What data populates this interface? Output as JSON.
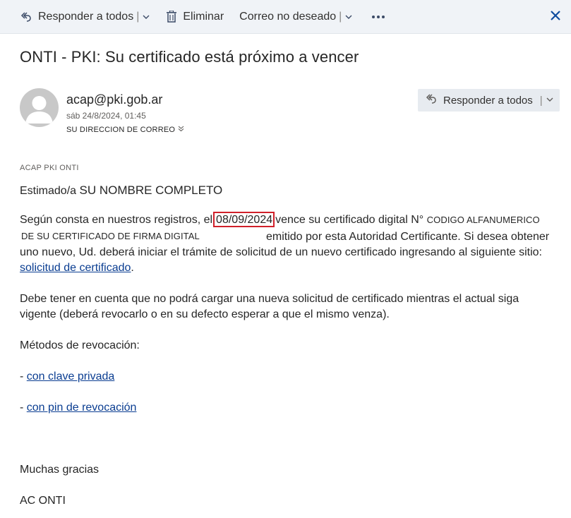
{
  "toolbar": {
    "reply_all_label": "Responder a todos",
    "delete_label": "Eliminar",
    "junk_label": "Correo no deseado",
    "more_icon": "more-icon",
    "close_icon": "close-icon"
  },
  "email": {
    "subject": "ONTI - PKI: Su certificado está próximo a vencer",
    "sender": "acap@pki.gob.ar",
    "date": "sáb 24/8/2024, 01:45",
    "recipient": "SU DIRECCION DE CORREO",
    "reply_all_label": "Responder a todos",
    "org": "ACAP PKI ONTI"
  },
  "body": {
    "greeting_prefix": "Estimado/a",
    "greeting_name": "SU NOMBRE COMPLETO",
    "p1_a": "Según consta en nuestros registros, el",
    "p1_date": "08/09/2024",
    "p1_b": "vence su certificado digital N°",
    "p1_code_1": "CODIGO ALFANUMERICO",
    "p1_code_2": "DE SU CERTIFICADO DE FIRMA DIGITAL",
    "p1_c": "emitido por esta Autoridad Certificante. Si desea obtener",
    "p1_d": "uno nuevo, Ud. deberá iniciar el trámite de solicitud de un nuevo certificado ingresando al siguiente sitio:",
    "p1_link": "solicitud de certificado",
    "p1_end": ".",
    "p2_a": "Debe tener en cuenta que no podrá cargar una nueva solicitud de certificado mientras el actual siga",
    "p2_b": "vigente (deberá revocarlo o en su defecto esperar a que el mismo venza).",
    "methods_title": "Métodos de revocación:",
    "dash": "-",
    "method_1": "con clave privada",
    "method_2": "con pin de revocación",
    "thanks": "Muchas gracias",
    "signature": "AC ONTI"
  },
  "colors": {
    "toolbar_bg": "#f0f3f7",
    "link": "#0a3d91",
    "highlight_border": "#d0202a",
    "accent_close": "#0f4c9e"
  }
}
